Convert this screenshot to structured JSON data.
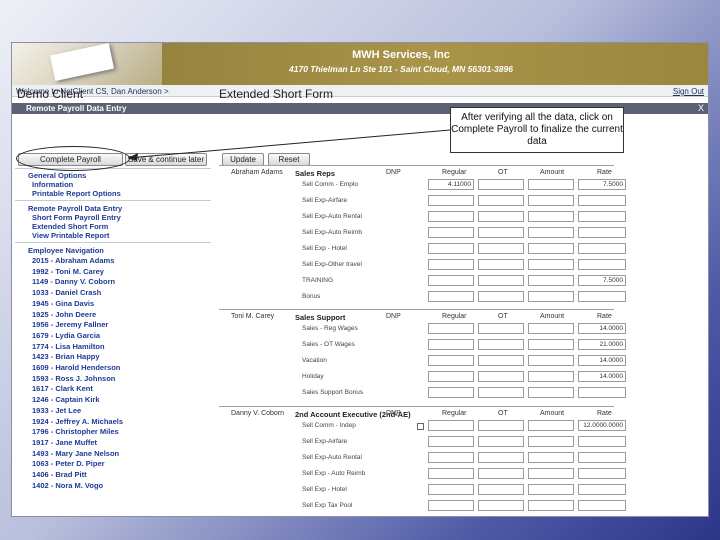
{
  "header": {
    "company": "MWH Services, Inc",
    "address": "4170 Thielman Ln Ste 101 - Saint Cloud, MN 56301-3896"
  },
  "welcome": {
    "text": "Welcome to NetClient CS, Dan Anderson",
    "arrow": ">",
    "signout": "Sign Out"
  },
  "bar": {
    "title": "Remote Payroll Data Entry",
    "close": "X"
  },
  "page": {
    "client": "Demo Client",
    "form": "Extended Short Form"
  },
  "buttons": {
    "complete": "Complete Payroll",
    "save": "Save & continue later",
    "update": "Update",
    "reset": "Reset"
  },
  "callout": "After verifying all the data, click on Complete Payroll to finalize the current data",
  "sidebar": {
    "general_title": "General Options",
    "general": [
      "Information",
      "Printable Report Options"
    ],
    "rpde_title": "Remote Payroll Data Entry",
    "rpde": [
      "Short Form Payroll Entry",
      "Extended Short Form",
      "View Printable Report"
    ],
    "emp_title": "Employee Navigation",
    "employees": [
      "2015 - Abraham Adams",
      "1992 - Toni M. Carey",
      "1149 - Danny V. Coborn",
      "1033 - Daniel Crash",
      "1945 - Gina Davis",
      "1925 - John Deere",
      "1956 - Jeremy Fallner",
      "1679 - Lydia Garcia",
      "1774 - Lisa Hamilton",
      "1423 - Brian Happy",
      "1609 - Harold Henderson",
      "1593 - Ross J. Johnson",
      "1617 - Clark Kent",
      "1246 - Captain Kirk",
      "1933 - Jet Lee",
      "1924 - Jeffrey A. Michaels",
      "1796 - Christopher Miles",
      "1917 - Jane Muffet",
      "1493 - Mary Jane Nelson",
      "1063 - Peter D. Piper",
      "1406 - Brad Pitt",
      "1402 - Nora M. Vogo"
    ]
  },
  "cols": {
    "dnp": "DNP",
    "regular": "Regular",
    "ot": "OT",
    "amount": "Amount",
    "rate": "Rate"
  },
  "groups": [
    {
      "employee": "Abraham Adams",
      "title": "Sales Reps",
      "rows": [
        {
          "label": "Sell Comm - Emplo",
          "regular": "4.11000",
          "rate": "7.5000"
        },
        {
          "label": "Sell Exp-Airfare",
          "regular": "",
          "rate": ""
        },
        {
          "label": "Sell Exp-Auto Rental",
          "regular": "",
          "rate": ""
        },
        {
          "label": "Sell Exp-Auto Reimb",
          "regular": "",
          "rate": ""
        },
        {
          "label": "Sell Exp - Hotel",
          "regular": "",
          "rate": ""
        },
        {
          "label": "Sell Exp-Other travel",
          "regular": "",
          "rate": ""
        },
        {
          "label": "TRAINING",
          "regular": "",
          "rate": "7.5000"
        },
        {
          "label": "Bonus",
          "regular": "",
          "rate": ""
        }
      ]
    },
    {
      "employee": "Toni M. Carey",
      "title": "Sales Support",
      "rows": [
        {
          "label": "Sales - Reg Wages",
          "regular": "",
          "rate": "14.0000"
        },
        {
          "label": "Sales - OT Wages",
          "regular": "",
          "rate": "21.0000"
        },
        {
          "label": "Vacation",
          "regular": "",
          "rate": "14.0000"
        },
        {
          "label": "Holiday",
          "regular": "",
          "rate": "14.0000"
        },
        {
          "label": "Sales Support Bonus",
          "regular": "",
          "rate": ""
        }
      ]
    },
    {
      "employee": "Danny V. Coborn",
      "title": "2nd Account Executive (2nd-AE)",
      "rows": [
        {
          "label": "Sell Comm - Indep",
          "regular": "",
          "rate": "12.0000.0000"
        },
        {
          "label": "Sell Exp-Airfare",
          "regular": "",
          "rate": ""
        },
        {
          "label": "Sell Exp-Auto Rental",
          "regular": "",
          "rate": ""
        },
        {
          "label": "Sell Exp - Auto Reimb",
          "regular": "",
          "rate": ""
        },
        {
          "label": "Sell Exp - Hotel",
          "regular": "",
          "rate": ""
        },
        {
          "label": "Sell Exp Tax Pool",
          "regular": "",
          "rate": ""
        }
      ]
    }
  ]
}
